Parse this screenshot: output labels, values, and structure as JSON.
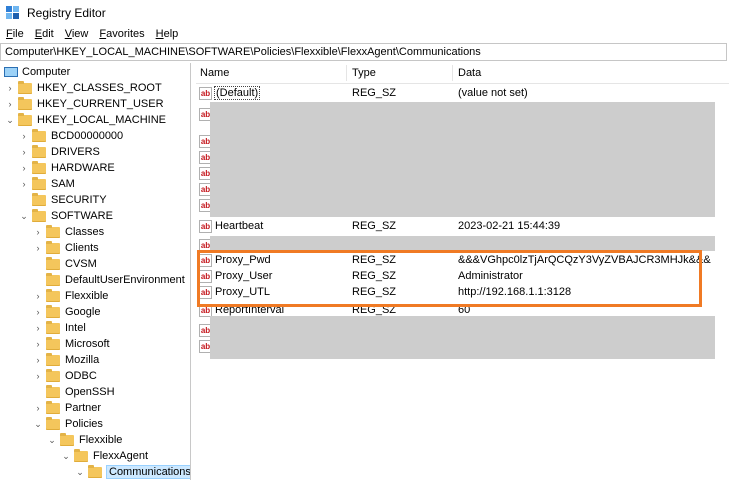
{
  "window": {
    "title": "Registry Editor"
  },
  "menu": [
    {
      "label": "File",
      "key": "F",
      "rest": "ile"
    },
    {
      "label": "Edit",
      "key": "E",
      "rest": "dit"
    },
    {
      "label": "View",
      "key": "V",
      "rest": "iew"
    },
    {
      "label": "Favorites",
      "key": "F",
      "rest": "avorites"
    },
    {
      "label": "Help",
      "key": "H",
      "rest": "elp"
    }
  ],
  "address": "Computer\\HKEY_LOCAL_MACHINE\\SOFTWARE\\Policies\\Flexxible\\FlexxAgent\\Communications",
  "tree": {
    "root": "Computer",
    "items": [
      "HKEY_CLASSES_ROOT",
      "HKEY_CURRENT_USER",
      "HKEY_LOCAL_MACHINE",
      "BCD00000000",
      "DRIVERS",
      "HARDWARE",
      "SAM",
      "SECURITY",
      "SOFTWARE",
      "Classes",
      "Clients",
      "CVSM",
      "DefaultUserEnvironment",
      "Flexxible",
      "Google",
      "Intel",
      "Microsoft",
      "Mozilla",
      "ODBC",
      "OpenSSH",
      "Partner",
      "Policies",
      "Flexxible",
      "FlexxAgent",
      "Communications"
    ]
  },
  "columns": {
    "name": "Name",
    "type": "Type",
    "data": "Data"
  },
  "values": {
    "default": {
      "name": "(Default)",
      "type": "REG_SZ",
      "data": "(value not set)"
    },
    "heartbeat": {
      "name": "Heartbeat",
      "type": "REG_SZ",
      "data": "2023-02-21 15:44:39"
    },
    "proxy_pwd": {
      "name": "Proxy_Pwd",
      "type": "REG_SZ",
      "data": "&&&VGhpc0lzTjArQCQzY3VyZVBAJCR3MHJk&&&"
    },
    "proxy_user": {
      "name": "Proxy_User",
      "type": "REG_SZ",
      "data": "Administrator"
    },
    "proxy_utl": {
      "name": "Proxy_UTL",
      "type": "REG_SZ",
      "data": "http://192.168.1.1:3128"
    },
    "report_interval": {
      "name": "ReportInterval",
      "type": "REG_SZ",
      "data": "60"
    }
  },
  "icons": {
    "string_value": "ab"
  },
  "colors": {
    "highlight": "#f07a24",
    "redaction": "#cdcdcd",
    "selection": "#cce8ff",
    "folder": "#f4c65c"
  }
}
